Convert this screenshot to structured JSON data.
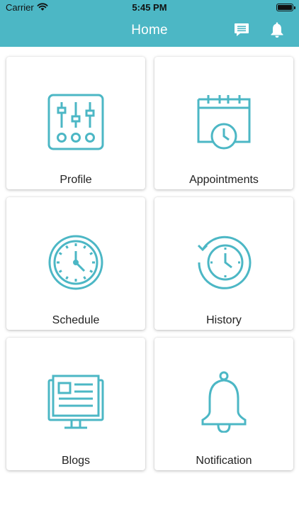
{
  "status_bar": {
    "carrier": "Carrier",
    "time": "5:45 PM"
  },
  "header": {
    "title": "Home",
    "icons": [
      "chat-icon",
      "bell-icon"
    ]
  },
  "tiles": [
    {
      "label": "Profile",
      "icon": "sliders-icon"
    },
    {
      "label": "Appointments",
      "icon": "calendar-clock-icon"
    },
    {
      "label": "Schedule",
      "icon": "clock-icon"
    },
    {
      "label": "History",
      "icon": "history-icon"
    },
    {
      "label": "Blogs",
      "icon": "monitor-article-icon"
    },
    {
      "label": "Notification",
      "icon": "bell-icon"
    }
  ],
  "colors": {
    "accent": "#4cb7c5",
    "background": "#ffffff",
    "text": "#222222"
  }
}
